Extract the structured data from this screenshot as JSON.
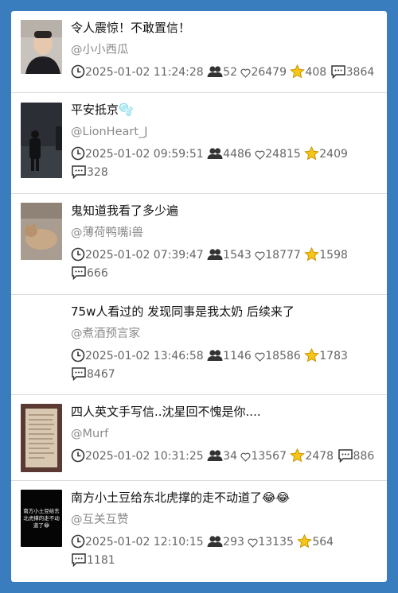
{
  "colors": {
    "background": "#3a7dbf",
    "card": "#ffffff",
    "star": "#f5c518"
  },
  "icons": {
    "time": "clock-icon",
    "viewers": "users-icon",
    "likes": "heart-icon",
    "favorites": "star-icon",
    "comments": "comment-icon"
  },
  "items": [
    {
      "title": "令人震惊！不敢置信！",
      "author": "@小小西瓜",
      "time": "2025-01-02 11:24:28",
      "viewers": "52",
      "likes": "26479",
      "favorites": "408",
      "comments": "3864"
    },
    {
      "title": "平安抵京🫧",
      "author": "@LionHeart_J",
      "time": "2025-01-02 09:59:51",
      "viewers": "4486",
      "likes": "24815",
      "favorites": "2409",
      "comments": "328"
    },
    {
      "title": "鬼知道我看了多少遍",
      "author": "@薄荷鸭嘴i兽",
      "time": "2025-01-02 07:39:47",
      "viewers": "1543",
      "likes": "18777",
      "favorites": "1598",
      "comments": "666"
    },
    {
      "title": "75w人看过的 发现同事是我太奶 后续来了",
      "author": "@煮酒预言家",
      "time": "2025-01-02 13:46:58",
      "viewers": "1146",
      "likes": "18586",
      "favorites": "1783",
      "comments": "8467"
    },
    {
      "title": "四人英文手写信..沈星回不愧是你....",
      "author": "@Murf",
      "time": "2025-01-02 10:31:25",
      "viewers": "34",
      "likes": "13567",
      "favorites": "2478",
      "comments": "886"
    },
    {
      "title": "南方小土豆给东北虎撑的走不动道了😂😂",
      "author": "@互关互赞",
      "time": "2025-01-02 12:10:15",
      "viewers": "293",
      "likes": "13135",
      "favorites": "564",
      "comments": "1181",
      "thumb_text": "南方小土豆给东北虎撑的走不动道了😂"
    }
  ]
}
